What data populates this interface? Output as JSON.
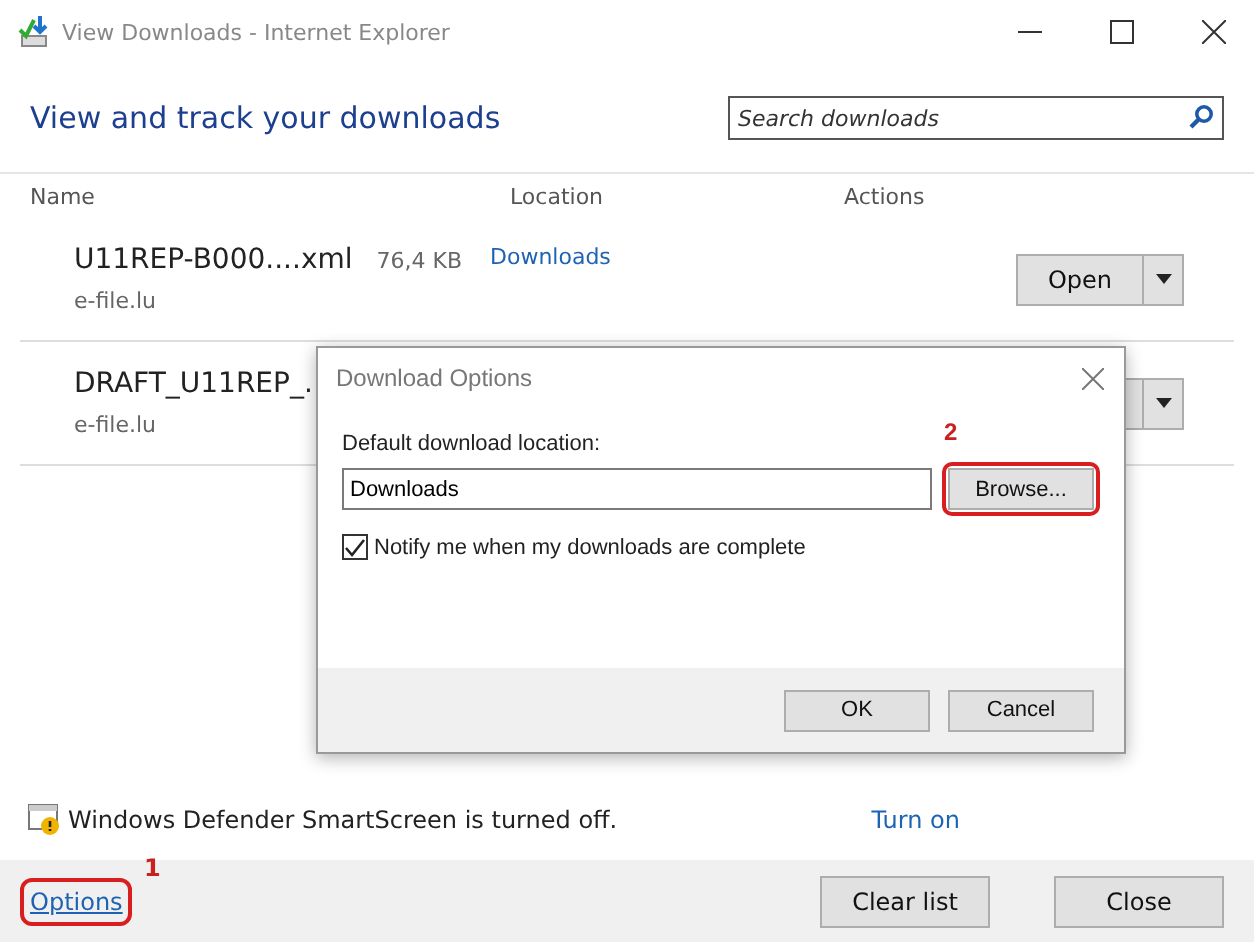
{
  "window": {
    "title": "View Downloads - Internet Explorer"
  },
  "header": {
    "title": "View and track your downloads",
    "search": {
      "placeholder": "Search downloads"
    }
  },
  "table": {
    "columns": [
      "Name",
      "Location",
      "Actions"
    ],
    "rows": [
      {
        "name": "U11REP-B000....xml",
        "size": "76,4 KB",
        "location": "Downloads",
        "source": "e-file.lu",
        "action": "Open"
      },
      {
        "name": "DRAFT_U11REP_.",
        "source": "e-file.lu"
      }
    ]
  },
  "smartscreen": {
    "message": "Windows Defender SmartScreen is turned off.",
    "link": "Turn on"
  },
  "footer": {
    "options_link": "Options",
    "options_marker": "1",
    "buttons": [
      "Clear list",
      "Close"
    ]
  },
  "dialog": {
    "title": "Download Options",
    "location_label": "Default download location:",
    "location_value": "Downloads",
    "browse": "Browse...",
    "browse_marker": "2",
    "notify": {
      "label": "Notify me when my downloads are complete",
      "checked": true
    },
    "buttons": [
      "OK",
      "Cancel"
    ]
  }
}
